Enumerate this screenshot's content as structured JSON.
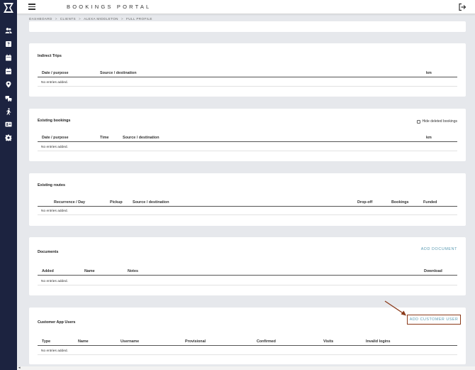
{
  "header": {
    "brand": "BOOKINGS PORTAL"
  },
  "breadcrumb": {
    "items": [
      "DASHBOARD",
      "CLIENTS",
      "ALEXA MIDDLETON",
      "FULL PROFILE"
    ]
  },
  "cards": {
    "indirect_trips": {
      "title": "Indirect Trips",
      "columns": [
        "Date / purpose",
        "Source / destination",
        "km"
      ],
      "empty": "No entries added."
    },
    "existing_bookings": {
      "title": "Existing bookings",
      "hide_deleted_label": "Hide deleted bookings",
      "hide_deleted_checked": false,
      "columns": [
        "Date / purpose",
        "Time",
        "Source / destination",
        "km"
      ],
      "empty": "No entries added."
    },
    "existing_routes": {
      "title": "Existing routes",
      "columns": [
        "Recurrence / Day",
        "Pickup",
        "Source / destination",
        "Drop-off",
        "Bookings",
        "Funded"
      ],
      "empty": "No entries added."
    },
    "documents": {
      "title": "Documents",
      "action": "ADD DOCUMENT",
      "columns": [
        "Added",
        "Name",
        "Notes",
        "Download"
      ],
      "empty": "No entries added."
    },
    "customer_app_users": {
      "title": "Customer App Users",
      "action": "ADD CUSTOMER USER",
      "columns": [
        "Type",
        "Name",
        "Username",
        "Provisional",
        "Confirmed",
        "Visits",
        "Invalid logins"
      ],
      "empty": "No entries added."
    }
  },
  "sidebar": {
    "icons": [
      "users-icon",
      "question-icon",
      "calendar-icon",
      "calendar-alt-icon",
      "map-pin-icon",
      "vehicles-icon",
      "walking-icon",
      "id-card-icon",
      "gear-icon"
    ]
  },
  "colors": {
    "sidebar": "#1c2340",
    "accent": "#5b9bb3",
    "highlight": "#8b3a1a",
    "background": "#e6e8ec"
  }
}
